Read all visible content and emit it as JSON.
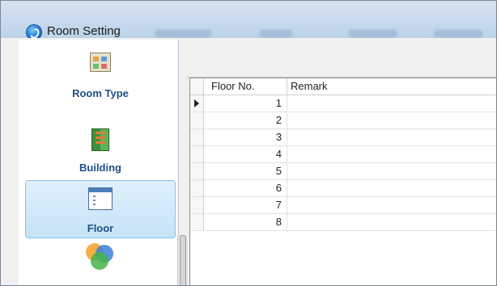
{
  "window": {
    "title": "Room Setting",
    "toolbar_blurred": [
      "Building",
      "Floor",
      "Remark"
    ]
  },
  "nav": {
    "items": [
      {
        "label": "Room Type",
        "icon": "room-type-icon",
        "selected": false
      },
      {
        "label": "Building",
        "icon": "building-icon",
        "selected": false
      },
      {
        "label": "Floor",
        "icon": "floor-icon",
        "selected": true
      },
      {
        "label": "",
        "icon": "venn-icon",
        "selected": false
      }
    ]
  },
  "grid": {
    "columns": [
      "Floor No.",
      "Remark"
    ],
    "rows": [
      {
        "floor": "1",
        "remark": "",
        "current": true
      },
      {
        "floor": "2",
        "remark": "",
        "current": false
      },
      {
        "floor": "3",
        "remark": "",
        "current": false
      },
      {
        "floor": "4",
        "remark": "",
        "current": false
      },
      {
        "floor": "5",
        "remark": "",
        "current": false
      },
      {
        "floor": "6",
        "remark": "",
        "current": false
      },
      {
        "floor": "7",
        "remark": "",
        "current": false
      },
      {
        "floor": "8",
        "remark": "",
        "current": false
      }
    ]
  },
  "colors": {
    "nav_label": "#1f4f88",
    "selection": "#c6e2f6",
    "titlebar": "#bcd2e8"
  }
}
